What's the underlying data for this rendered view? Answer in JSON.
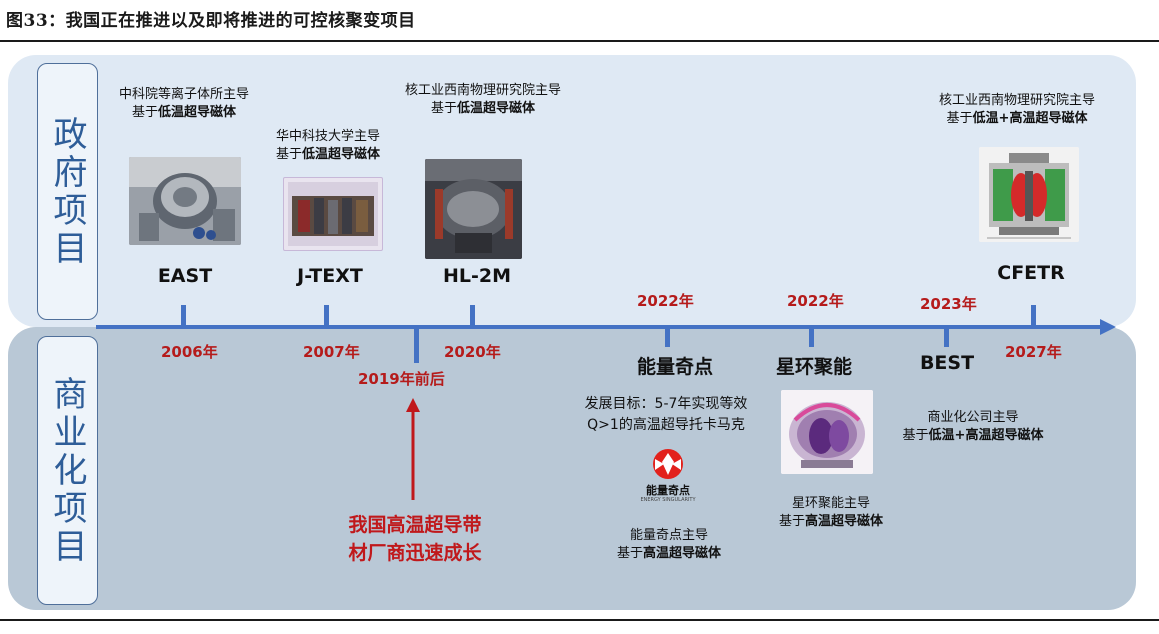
{
  "title": "图33：我国正在推进以及即将推进的可控核聚变项目",
  "sections": {
    "government": "政府项目",
    "commercial": "商业化项目"
  },
  "projects": {
    "east": {
      "name": "EAST",
      "year": "2006年",
      "desc1": "中科院等离子体所主导",
      "desc2_pre": "基于",
      "desc2_bold": "低温超导磁体"
    },
    "jtext": {
      "name": "J-TEXT",
      "year": "2007年",
      "desc1": "华中科技大学主导",
      "desc2_pre": "基于",
      "desc2_bold": "低温超导磁体"
    },
    "hl2m": {
      "name": "HL-2M",
      "year": "2020年",
      "desc1": "核工业西南物理研究院主导",
      "desc2_pre": "基于",
      "desc2_bold": "低温超导磁体"
    },
    "cfetr": {
      "name": "CFETR",
      "year": "2027年",
      "desc1": "核工业西南物理研究院主导",
      "desc2_pre": "基于",
      "desc2_bold": "低温+高温超导磁体"
    },
    "energy_singularity": {
      "name": "能量奇点",
      "year": "2022年",
      "goal1": "发展目标：5-7年实现等效",
      "goal2": "Q>1的高温超导托卡马克",
      "logo_text": "能量奇点",
      "logo_sub": "ENERGY SINGULARITY",
      "desc1": "能量奇点主导",
      "desc2_pre": "基于",
      "desc2_bold": "高温超导磁体"
    },
    "startorus": {
      "name": "星环聚能",
      "year": "2022年",
      "desc1": "星环聚能主导",
      "desc2_pre": "基于",
      "desc2_bold": "高温超导磁体"
    },
    "best": {
      "name": "BEST",
      "year": "2023年",
      "desc1": "商业化公司主导",
      "desc2_pre": "基于",
      "desc2_bold": "低温+高温超导磁体"
    }
  },
  "marker": {
    "year": "2019年前后",
    "note1": "我国高温超导带",
    "note2": "材厂商迅速成长"
  },
  "colors": {
    "axis": "#4472c4",
    "year_red": "#b51b1b",
    "note_red": "#c0181b",
    "side_text": "#2e5d98"
  }
}
